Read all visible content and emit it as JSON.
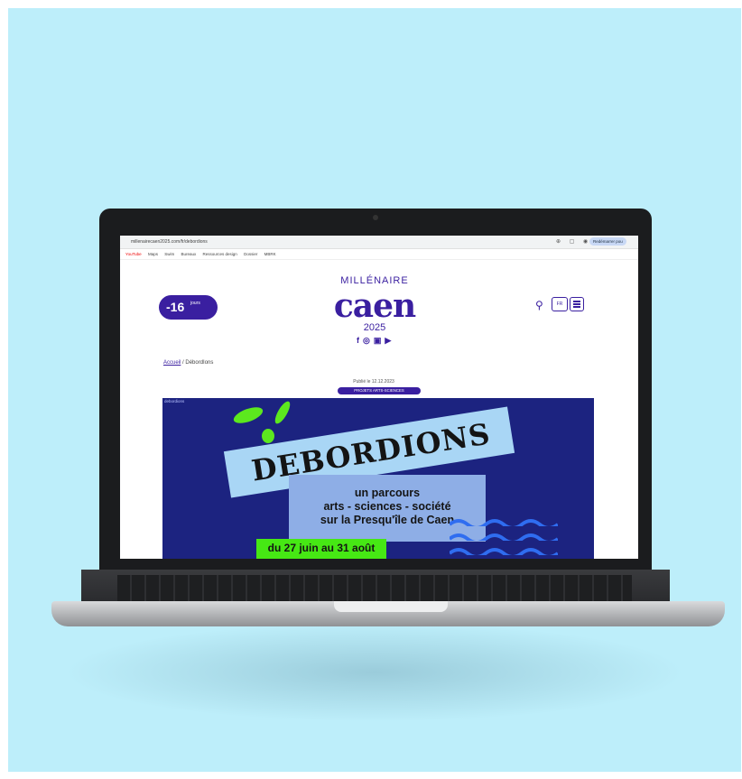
{
  "browser": {
    "url": "millenairecaen2025.com/fr/debordions",
    "profile_label": "Redémarrer pou",
    "bookmarks": [
      "YouTube",
      "Maps",
      "Swim",
      "Bureaux",
      "Ressources design",
      "Dossier",
      "MBRK"
    ]
  },
  "page": {
    "countdown": {
      "number": "-16",
      "unit": "jours"
    },
    "logo": {
      "top": "MILLÉNAIRE",
      "main": "caen",
      "year": "2025"
    },
    "social_icons": [
      "facebook-icon",
      "instagram-icon",
      "linkedin-icon",
      "youtube-icon"
    ],
    "lang_label": "FR",
    "breadcrumb": {
      "home": "Accueil",
      "separator": "/",
      "current": "DébordIons"
    },
    "published": "Publié le 12.12.2023",
    "category_tag": "PROJETS ARTS-SCIENCES"
  },
  "poster": {
    "caption": "debordions",
    "title": "DEBORDIONS",
    "subtitle_lines": [
      "un parcours",
      "arts - sciences - société",
      "sur la Presqu'île de Caen"
    ],
    "dates": "du 27 juin au 31 août",
    "colors": {
      "background": "#1c2380",
      "green": "#46e814",
      "band": "#a9d6f5",
      "box": "#8eaee6"
    }
  },
  "colors": {
    "brand": "#3a1fa0",
    "backdrop": "#bdeefa"
  }
}
